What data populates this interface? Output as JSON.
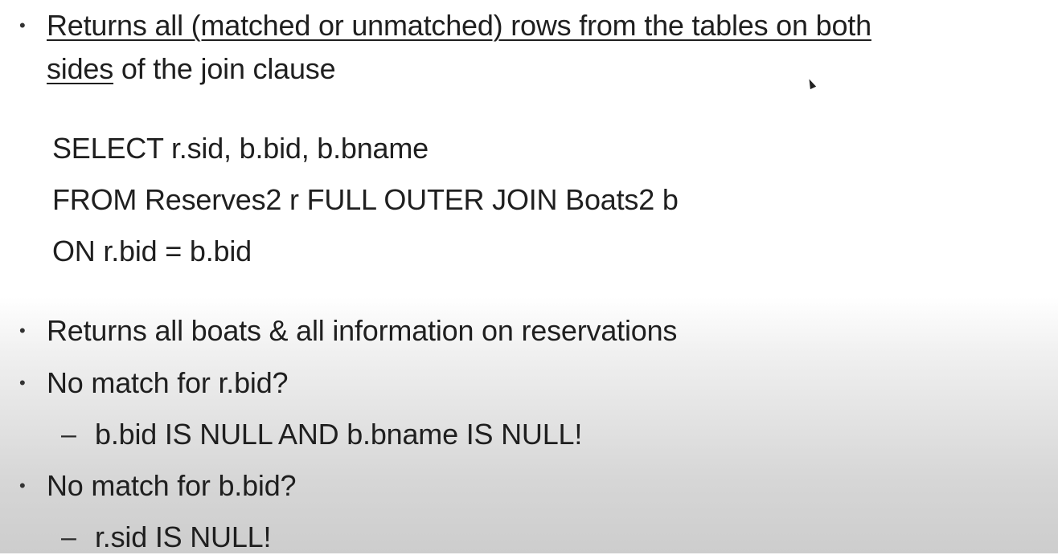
{
  "bullets": {
    "b1_part1": "Returns all (matched or unmatched) rows from the tables on both",
    "b1_part2_underlined": "sides",
    "b1_part2_rest": " of the join clause",
    "b2": "Returns all boats & all information on reservations",
    "b3": "No match for r.bid?",
    "b3_sub": "b.bid IS NULL AND b.bname IS NULL!",
    "b4": "No match for b.bid?",
    "b4_sub": "r.sid IS NULL!"
  },
  "sql": {
    "line1": "SELECT r.sid, b.bid, b.bname",
    "line2": "FROM Reserves2 r FULL OUTER JOIN Boats2 b",
    "line3": "ON r.bid = b.bid"
  },
  "glyphs": {
    "bullet": "•",
    "dash": "–"
  },
  "icons": {
    "cursor": "mouse-pointer-icon"
  }
}
